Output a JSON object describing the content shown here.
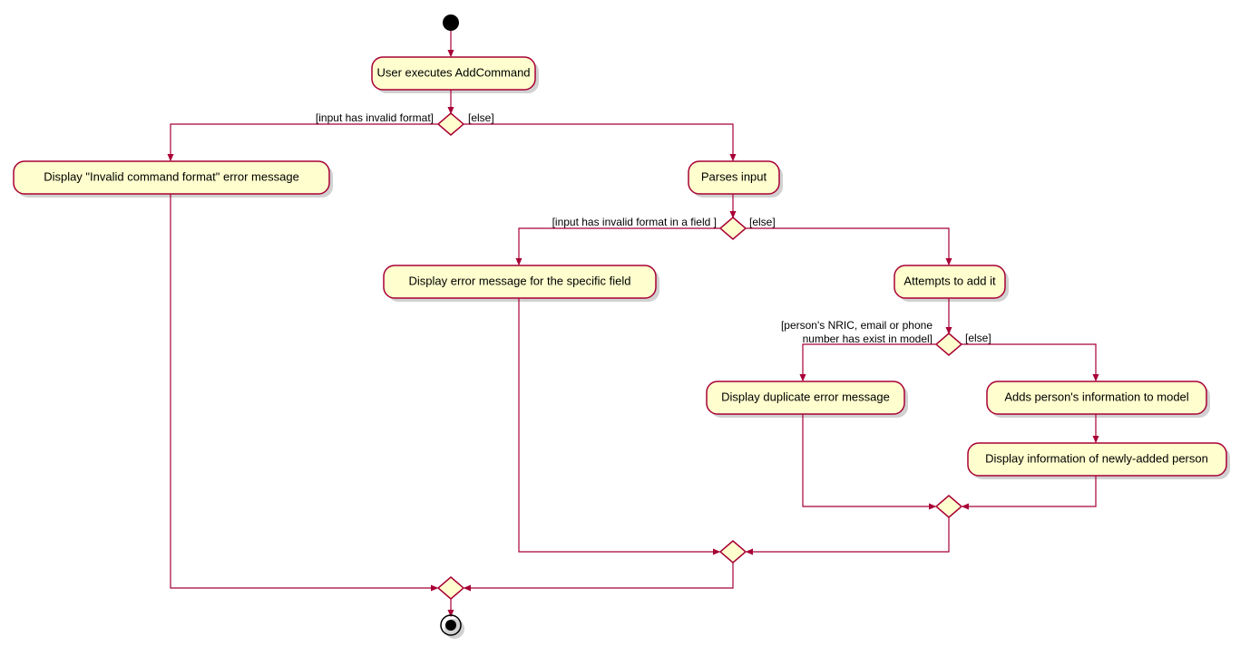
{
  "nodes": {
    "start_activity": "User executes AddCommand",
    "invalid_cmd": "Display \"Invalid command format\" error message",
    "parses": "Parses input",
    "field_err": "Display error message for the specific field",
    "attempts": "Attempts to add it",
    "dup_err": "Display duplicate error message",
    "adds": "Adds person's information to model",
    "newly": "Display information of newly-added person"
  },
  "guards": {
    "g1_left": "[input has invalid format]",
    "g1_right": "[else]",
    "g2_left": "[input has invalid format in a field ]",
    "g2_right": "[else]",
    "g3_left_l1": "[person's NRIC, email or phone",
    "g3_left_l2": "number has exist in model]",
    "g3_right": "[else]"
  }
}
